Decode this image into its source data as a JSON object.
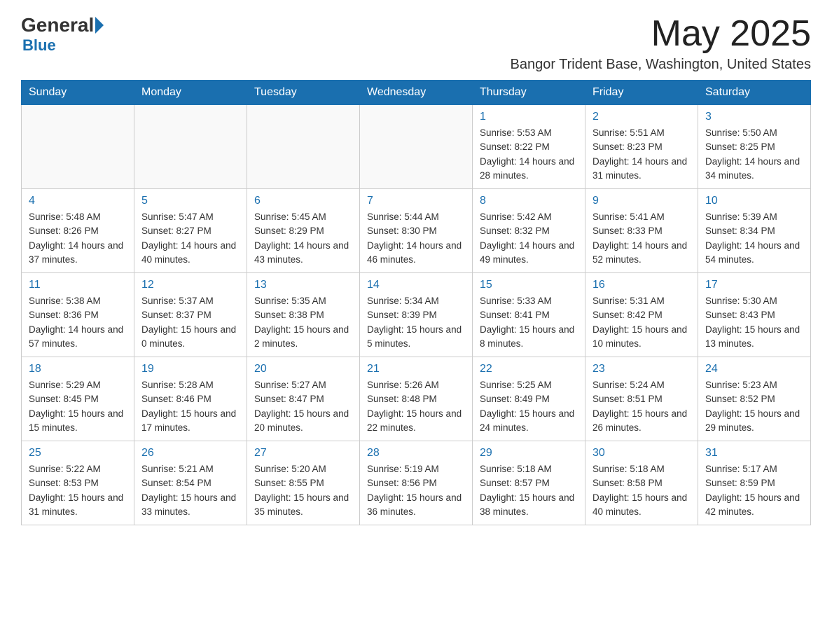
{
  "header": {
    "logo_general": "General",
    "logo_blue": "Blue",
    "month_title": "May 2025",
    "location": "Bangor Trident Base, Washington, United States"
  },
  "days_of_week": [
    "Sunday",
    "Monday",
    "Tuesday",
    "Wednesday",
    "Thursday",
    "Friday",
    "Saturday"
  ],
  "weeks": [
    [
      {
        "day": "",
        "info": ""
      },
      {
        "day": "",
        "info": ""
      },
      {
        "day": "",
        "info": ""
      },
      {
        "day": "",
        "info": ""
      },
      {
        "day": "1",
        "info": "Sunrise: 5:53 AM\nSunset: 8:22 PM\nDaylight: 14 hours and 28 minutes."
      },
      {
        "day": "2",
        "info": "Sunrise: 5:51 AM\nSunset: 8:23 PM\nDaylight: 14 hours and 31 minutes."
      },
      {
        "day": "3",
        "info": "Sunrise: 5:50 AM\nSunset: 8:25 PM\nDaylight: 14 hours and 34 minutes."
      }
    ],
    [
      {
        "day": "4",
        "info": "Sunrise: 5:48 AM\nSunset: 8:26 PM\nDaylight: 14 hours and 37 minutes."
      },
      {
        "day": "5",
        "info": "Sunrise: 5:47 AM\nSunset: 8:27 PM\nDaylight: 14 hours and 40 minutes."
      },
      {
        "day": "6",
        "info": "Sunrise: 5:45 AM\nSunset: 8:29 PM\nDaylight: 14 hours and 43 minutes."
      },
      {
        "day": "7",
        "info": "Sunrise: 5:44 AM\nSunset: 8:30 PM\nDaylight: 14 hours and 46 minutes."
      },
      {
        "day": "8",
        "info": "Sunrise: 5:42 AM\nSunset: 8:32 PM\nDaylight: 14 hours and 49 minutes."
      },
      {
        "day": "9",
        "info": "Sunrise: 5:41 AM\nSunset: 8:33 PM\nDaylight: 14 hours and 52 minutes."
      },
      {
        "day": "10",
        "info": "Sunrise: 5:39 AM\nSunset: 8:34 PM\nDaylight: 14 hours and 54 minutes."
      }
    ],
    [
      {
        "day": "11",
        "info": "Sunrise: 5:38 AM\nSunset: 8:36 PM\nDaylight: 14 hours and 57 minutes."
      },
      {
        "day": "12",
        "info": "Sunrise: 5:37 AM\nSunset: 8:37 PM\nDaylight: 15 hours and 0 minutes."
      },
      {
        "day": "13",
        "info": "Sunrise: 5:35 AM\nSunset: 8:38 PM\nDaylight: 15 hours and 2 minutes."
      },
      {
        "day": "14",
        "info": "Sunrise: 5:34 AM\nSunset: 8:39 PM\nDaylight: 15 hours and 5 minutes."
      },
      {
        "day": "15",
        "info": "Sunrise: 5:33 AM\nSunset: 8:41 PM\nDaylight: 15 hours and 8 minutes."
      },
      {
        "day": "16",
        "info": "Sunrise: 5:31 AM\nSunset: 8:42 PM\nDaylight: 15 hours and 10 minutes."
      },
      {
        "day": "17",
        "info": "Sunrise: 5:30 AM\nSunset: 8:43 PM\nDaylight: 15 hours and 13 minutes."
      }
    ],
    [
      {
        "day": "18",
        "info": "Sunrise: 5:29 AM\nSunset: 8:45 PM\nDaylight: 15 hours and 15 minutes."
      },
      {
        "day": "19",
        "info": "Sunrise: 5:28 AM\nSunset: 8:46 PM\nDaylight: 15 hours and 17 minutes."
      },
      {
        "day": "20",
        "info": "Sunrise: 5:27 AM\nSunset: 8:47 PM\nDaylight: 15 hours and 20 minutes."
      },
      {
        "day": "21",
        "info": "Sunrise: 5:26 AM\nSunset: 8:48 PM\nDaylight: 15 hours and 22 minutes."
      },
      {
        "day": "22",
        "info": "Sunrise: 5:25 AM\nSunset: 8:49 PM\nDaylight: 15 hours and 24 minutes."
      },
      {
        "day": "23",
        "info": "Sunrise: 5:24 AM\nSunset: 8:51 PM\nDaylight: 15 hours and 26 minutes."
      },
      {
        "day": "24",
        "info": "Sunrise: 5:23 AM\nSunset: 8:52 PM\nDaylight: 15 hours and 29 minutes."
      }
    ],
    [
      {
        "day": "25",
        "info": "Sunrise: 5:22 AM\nSunset: 8:53 PM\nDaylight: 15 hours and 31 minutes."
      },
      {
        "day": "26",
        "info": "Sunrise: 5:21 AM\nSunset: 8:54 PM\nDaylight: 15 hours and 33 minutes."
      },
      {
        "day": "27",
        "info": "Sunrise: 5:20 AM\nSunset: 8:55 PM\nDaylight: 15 hours and 35 minutes."
      },
      {
        "day": "28",
        "info": "Sunrise: 5:19 AM\nSunset: 8:56 PM\nDaylight: 15 hours and 36 minutes."
      },
      {
        "day": "29",
        "info": "Sunrise: 5:18 AM\nSunset: 8:57 PM\nDaylight: 15 hours and 38 minutes."
      },
      {
        "day": "30",
        "info": "Sunrise: 5:18 AM\nSunset: 8:58 PM\nDaylight: 15 hours and 40 minutes."
      },
      {
        "day": "31",
        "info": "Sunrise: 5:17 AM\nSunset: 8:59 PM\nDaylight: 15 hours and 42 minutes."
      }
    ]
  ]
}
